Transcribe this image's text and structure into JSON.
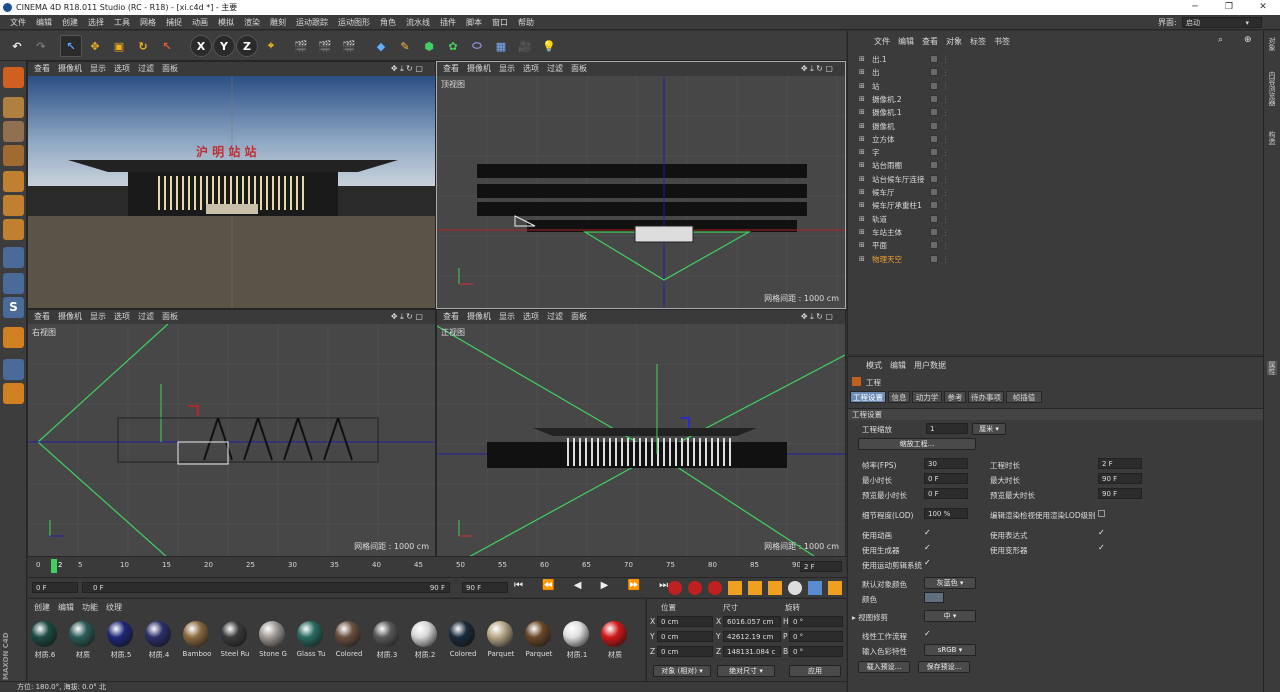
{
  "window": {
    "title": "CINEMA 4D R18.011 Studio (RC - R18) - [xi.c4d *] - 主要",
    "layout_label": "界面:",
    "layout_value": "启动"
  },
  "menu": [
    "文件",
    "编辑",
    "创建",
    "选择",
    "工具",
    "网格",
    "捕捉",
    "动画",
    "模拟",
    "渲染",
    "雕刻",
    "运动跟踪",
    "运动图形",
    "角色",
    "流水线",
    "插件",
    "脚本",
    "窗口",
    "帮助"
  ],
  "toolbar": {
    "x": "X",
    "y": "Y",
    "z": "Z"
  },
  "viewport_menu": [
    "查看",
    "摄像机",
    "显示",
    "选项",
    "过滤",
    "面板"
  ],
  "viewports": {
    "top": {
      "label": "顶视图",
      "grid": "网格间距 : 1000 cm"
    },
    "right": {
      "label": "右视图",
      "grid": "网格间距 : 1000 cm"
    },
    "front": {
      "label": "正视图",
      "grid": "网格间距 : 1000 cm"
    },
    "persp_sign": "沪 明 站 站"
  },
  "timeline": {
    "ticks": [
      "0",
      "5",
      "10",
      "15",
      "20",
      "25",
      "30",
      "35",
      "40",
      "45",
      "50",
      "55",
      "60",
      "65",
      "70",
      "75",
      "80",
      "85",
      "90"
    ],
    "current": "2",
    "end_frame": "2 F",
    "start_field": "0 F",
    "range_start": "0 F",
    "range_end": "90 F",
    "max_field": "90 F"
  },
  "materials": {
    "menu": [
      "创建",
      "编辑",
      "功能",
      "纹理"
    ],
    "items": [
      {
        "name": "材质.6",
        "color": "#1c4a44"
      },
      {
        "name": "材质",
        "color": "#2c5c58"
      },
      {
        "name": "材质.5",
        "color": "#1f2778"
      },
      {
        "name": "材质.4",
        "color": "#2a2f6a"
      },
      {
        "name": "Bamboo",
        "color": "#8a6a40"
      },
      {
        "name": "Steel Ru",
        "color": "#3a3a3a"
      },
      {
        "name": "Stone G",
        "color": "#a09a96"
      },
      {
        "name": "Glass Tu",
        "color": "#2a6a62"
      },
      {
        "name": "Colored",
        "color": "#6a5040"
      },
      {
        "name": "材质.3",
        "color": "#5a5a5a"
      },
      {
        "name": "材质.2",
        "color": "#d8d8d8"
      },
      {
        "name": "Colored",
        "color": "#1a2a3a"
      },
      {
        "name": "Parquet",
        "color": "#b8a888"
      },
      {
        "name": "Parquet",
        "color": "#6a4828"
      },
      {
        "name": "材质.1",
        "color": "#e0e0e0"
      },
      {
        "name": "材质",
        "color": "#d01818"
      }
    ]
  },
  "coords": {
    "headers": [
      "位置",
      "尺寸",
      "旋转"
    ],
    "rows": [
      {
        "axis": "X",
        "pos": "0 cm",
        "size": "6016.057 cm",
        "rot_axis": "H",
        "rot": "0 °"
      },
      {
        "axis": "Y",
        "pos": "0 cm",
        "size": "42612.19 cm",
        "rot_axis": "P",
        "rot": "0 °"
      },
      {
        "axis": "Z",
        "pos": "0 cm",
        "size": "148131.084 c",
        "rot_axis": "B",
        "rot": "0 °"
      }
    ],
    "mode": "对象 (相对)",
    "size_mode": "绝对尺寸",
    "apply": "应用"
  },
  "status": "方位: 180.0°, 海拔: 0.0° 北",
  "object_manager": {
    "menu": [
      "文件",
      "编辑",
      "查看",
      "对象",
      "标签",
      "书签"
    ],
    "objects": [
      {
        "name": "出.1",
        "active": false
      },
      {
        "name": "出",
        "active": false
      },
      {
        "name": "站",
        "active": false
      },
      {
        "name": "摄像机.2",
        "active": false
      },
      {
        "name": "摄像机.1",
        "active": false
      },
      {
        "name": "摄像机",
        "active": false
      },
      {
        "name": "立方体",
        "active": false
      },
      {
        "name": "字",
        "active": false
      },
      {
        "name": "站台雨棚",
        "active": false
      },
      {
        "name": "站台候车厅连接",
        "active": false
      },
      {
        "name": "候车厅",
        "active": false
      },
      {
        "name": "候车厅承重柱1",
        "active": false
      },
      {
        "name": "轨道",
        "active": false
      },
      {
        "name": "车站主体",
        "active": false
      },
      {
        "name": "平面",
        "active": false
      },
      {
        "name": "物理天空",
        "active": true
      }
    ]
  },
  "attributes": {
    "menu": [
      "模式",
      "编辑",
      "用户数据"
    ],
    "object": "工程",
    "tabs": [
      "工程设置",
      "信息",
      "动力学",
      "参考",
      "待办事项",
      "帧插值"
    ],
    "section": "工程设置",
    "scale_label": "工程缩放",
    "scale_value": "1",
    "scale_unit": "厘米",
    "scale_button": "缩放工程...",
    "fps_label": "帧率(FPS)",
    "fps": "30",
    "duration_label": "工程时长",
    "duration": "2 F",
    "min_label": "最小时长",
    "min": "0 F",
    "max_label": "最大时长",
    "max": "90 F",
    "pmin_label": "预览最小时长",
    "pmin": "0 F",
    "pmax_label": "预览最大时长",
    "pmax": "90 F",
    "lod_label": "细节程度(LOD)",
    "lod": "100 %",
    "lod_render": "编辑渲染检视使用渲染LOD级别",
    "use_anim": "使用动画",
    "use_expr": "使用表达式",
    "use_gen": "使用生成器",
    "use_deform": "使用变形器",
    "use_motion": "使用运动剪辑系统",
    "default_color_label": "默认对象颜色",
    "default_color": "灰蓝色",
    "color_label": "颜色",
    "view_clip_label": "视图修剪",
    "view_clip": "中",
    "linear_label": "线性工作流程",
    "input_color_label": "输入色彩特性",
    "input_color": "sRGB",
    "load_preset": "载入预设...",
    "save_preset": "保存预设..."
  },
  "right_tabs": [
    "对象",
    "内容浏览器",
    "构造"
  ],
  "right_tabs2": [
    "属性"
  ]
}
